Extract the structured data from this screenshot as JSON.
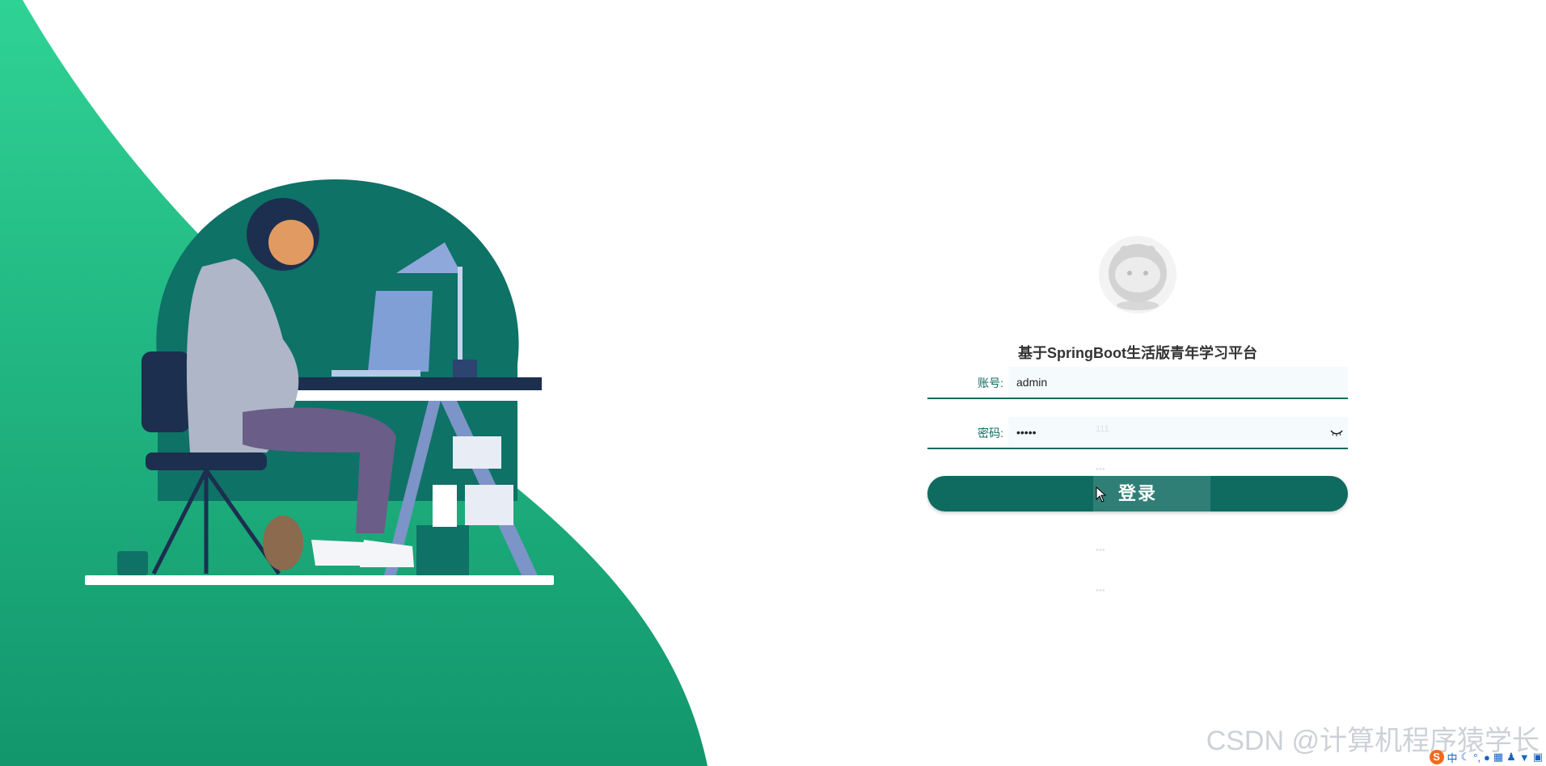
{
  "app": {
    "title": "基于SpringBoot生活版青年学习平台"
  },
  "form": {
    "account_label": "账号:",
    "account_value": "admin",
    "password_label": "密码:",
    "password_value": "•••••"
  },
  "login_button": {
    "label": "登录"
  },
  "autofill_ghost": [
    "111",
    "•••",
    "•••",
    "•••",
    "•••"
  ],
  "watermark": {
    "text": "CSDN @计算机程序猿学长"
  },
  "tray": {
    "ime_label": "中",
    "logo_label": "S"
  },
  "colors": {
    "primary": "#0f6b60",
    "green_light": "#2ecf8e",
    "green_dark": "#129a6f",
    "teal_circle": "#0e7266"
  }
}
